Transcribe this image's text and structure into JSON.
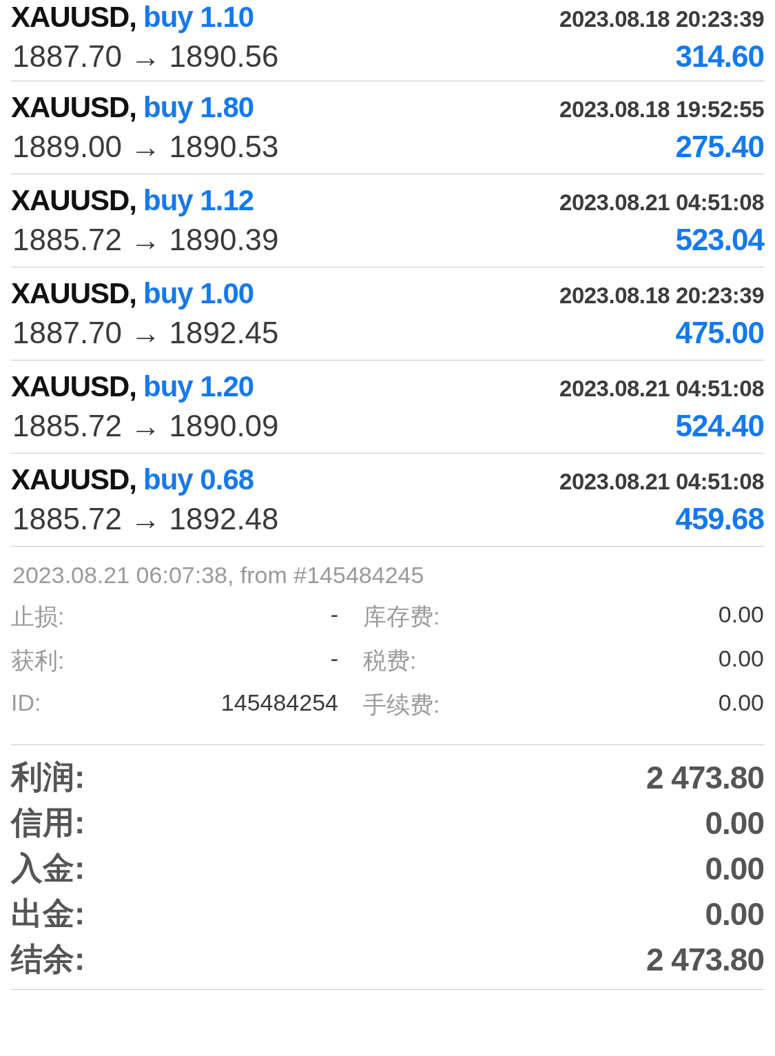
{
  "trades": [
    {
      "symbol": "XAUUSD,",
      "side": "buy 1.10",
      "time": "2023.08.18 20:23:39",
      "prices": "1887.70 → 1890.56",
      "profit": "314.60"
    },
    {
      "symbol": "XAUUSD,",
      "side": "buy 1.80",
      "time": "2023.08.18 19:52:55",
      "prices": "1889.00 → 1890.53",
      "profit": "275.40"
    },
    {
      "symbol": "XAUUSD,",
      "side": "buy 1.12",
      "time": "2023.08.21 04:51:08",
      "prices": "1885.72 → 1890.39",
      "profit": "523.04"
    },
    {
      "symbol": "XAUUSD,",
      "side": "buy 1.00",
      "time": "2023.08.18 20:23:39",
      "prices": "1887.70 → 1892.45",
      "profit": "475.00"
    },
    {
      "symbol": "XAUUSD,",
      "side": "buy 1.20",
      "time": "2023.08.21 04:51:08",
      "prices": "1885.72 → 1890.09",
      "profit": "524.40"
    },
    {
      "symbol": "XAUUSD,",
      "side": "buy 0.68",
      "time": "2023.08.21 04:51:08",
      "prices": "1885.72 → 1892.48",
      "profit": "459.68"
    }
  ],
  "details": {
    "comment": "2023.08.21 06:07:38, from #145484245",
    "rows": [
      {
        "left_label": "止损:",
        "left_value": "-",
        "right_label": "库存费:",
        "right_value": "0.00"
      },
      {
        "left_label": "获利:",
        "left_value": "-",
        "right_label": "税费:",
        "right_value": "0.00"
      },
      {
        "left_label": "ID:",
        "left_value": "145484254",
        "right_label": "手续费:",
        "right_value": "0.00"
      }
    ]
  },
  "summary": [
    {
      "label": "利润:",
      "value": "2 473.80"
    },
    {
      "label": "信用:",
      "value": "0.00"
    },
    {
      "label": "入金:",
      "value": "0.00"
    },
    {
      "label": "出金:",
      "value": "0.00"
    },
    {
      "label": "结余:",
      "value": "2 473.80"
    }
  ]
}
